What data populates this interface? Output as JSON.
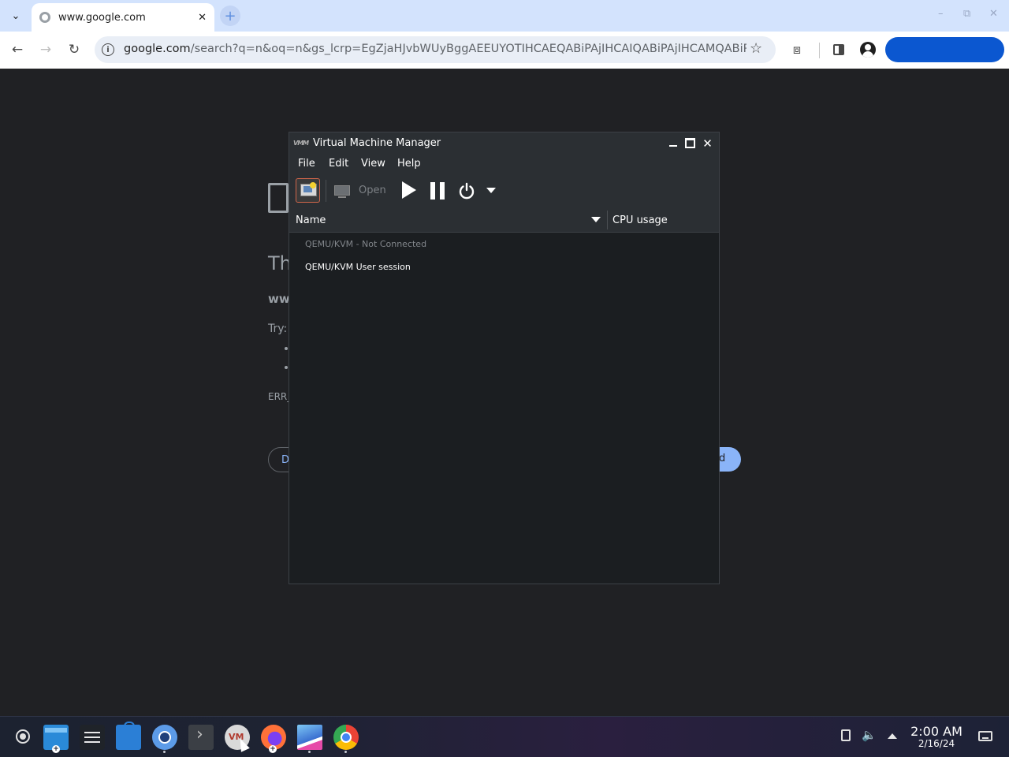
{
  "browser": {
    "tab_title": "www.google.com",
    "tab_close": "✕",
    "new_tab": "+",
    "url_host": "google.com",
    "url_path": "/search?q=n&oq=n&gs_lcrp=EgZjaHJvbWUyBggAEEUYOTIHCAEQABiPAjIHCAIQABiPAjIHCAMQABiPAtIBCT...",
    "win_minimize": "–",
    "win_restore": "⧉",
    "win_close": "✕",
    "info_glyph": "i",
    "star_glyph": "☆",
    "back_glyph": "←",
    "forward_glyph": "→",
    "reload_glyph": "↻",
    "tab_search_glyph": "⌄",
    "extensions_glyph": "⧈"
  },
  "error_page": {
    "title_fragment": "Th",
    "host_fragment": "ww",
    "try_label": "Try:",
    "error_code_fragment": "ERR_",
    "left_button_fragment": "D",
    "right_button_fragment": "d"
  },
  "vmm": {
    "title": "Virtual Machine Manager",
    "logo_text": "VMM",
    "close_glyph": "✕",
    "menu": [
      "File",
      "Edit",
      "View",
      "Help"
    ],
    "toolbar": {
      "open_label": "Open"
    },
    "columns": {
      "name": "Name",
      "cpu": "CPU usage"
    },
    "connections": [
      {
        "label": "QEMU/KVM - Not Connected",
        "state": "disconnected"
      },
      {
        "label": "QEMU/KVM User session",
        "state": "connected"
      }
    ]
  },
  "taskbar": {
    "time": "2:00 AM",
    "date": "2/16/24",
    "volume_glyph": "🔈",
    "badge_glyph": "+"
  },
  "colors": {
    "accent_blue": "#0b57d0",
    "error_button_blue": "#8ab4f8",
    "window_bg": "#1b1e21"
  }
}
